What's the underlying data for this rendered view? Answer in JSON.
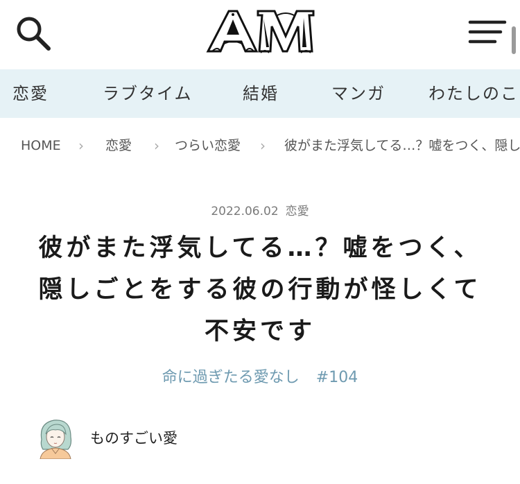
{
  "header": {
    "logo_text": "AM"
  },
  "nav": {
    "items": [
      {
        "label": "恋愛"
      },
      {
        "label": "ラブタイム"
      },
      {
        "label": "結婚"
      },
      {
        "label": "マンガ"
      },
      {
        "label": "わたしのこ"
      }
    ]
  },
  "breadcrumb": {
    "items": [
      "HOME",
      "恋愛",
      "つらい恋愛",
      "彼がまた浮気してる…？嘘をつく、隠し"
    ]
  },
  "article": {
    "date": "2022.06.02",
    "category": "恋愛",
    "title_line1": "彼がまた浮気してる…？嘘をつく、",
    "title_line2": "隠しごとをする彼の行動が怪しくて",
    "title_line3": "不安です",
    "series_name": "命に過ぎたる愛なし",
    "series_number": "#104",
    "author": "ものすごい愛"
  },
  "colors": {
    "nav_bg": "#e6f2f6",
    "series_link": "#6e9ab0",
    "text": "#222222"
  },
  "icons": [
    "search-icon",
    "hamburger-menu-icon",
    "chevron-right-icon",
    "avatar-illustration"
  ]
}
